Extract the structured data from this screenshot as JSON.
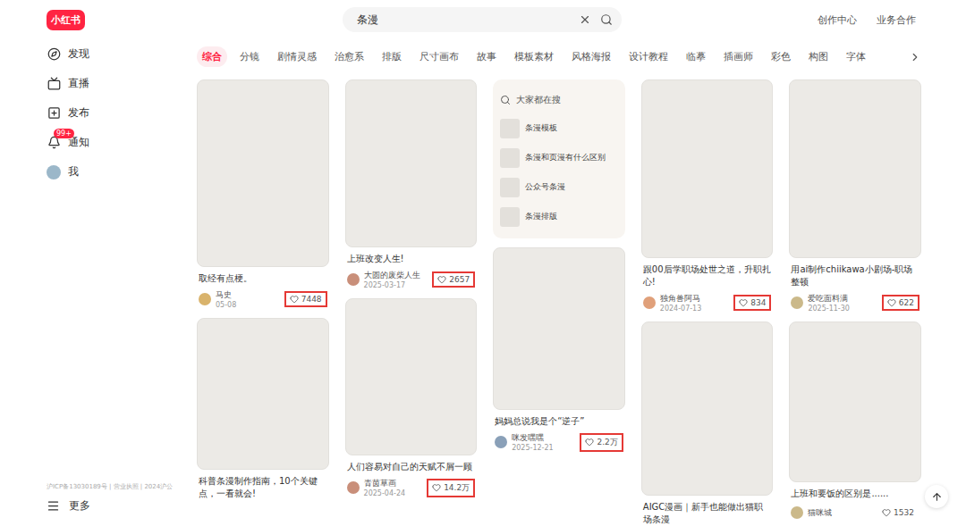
{
  "logo": "小红书",
  "search": {
    "value": "条漫"
  },
  "header_links": [
    "创作中心",
    "业务合作"
  ],
  "sidebar": {
    "items": [
      {
        "label": "发现",
        "selected": false,
        "icon": "compass"
      },
      {
        "label": "直播",
        "selected": false,
        "icon": "tv"
      },
      {
        "label": "发布",
        "selected": false,
        "icon": "plus"
      },
      {
        "label": "通知",
        "selected": false,
        "icon": "bell",
        "badge": "99+"
      },
      {
        "label": "我",
        "selected": false,
        "icon": "avatar"
      }
    ],
    "footer": "沪ICP备13030189号 | 营业执照 | 2024沪公",
    "more": "更多"
  },
  "tabs": [
    {
      "label": "综合",
      "selected": true
    },
    {
      "label": "分镜",
      "selected": false
    },
    {
      "label": "剧情灵感",
      "selected": false
    },
    {
      "label": "治愈系",
      "selected": false
    },
    {
      "label": "排版",
      "selected": false
    },
    {
      "label": "尺寸画布",
      "selected": false
    },
    {
      "label": "故事",
      "selected": false
    },
    {
      "label": "模板素材",
      "selected": false
    },
    {
      "label": "风格海报",
      "selected": false
    },
    {
      "label": "设计教程",
      "selected": false
    },
    {
      "label": "临摹",
      "selected": false
    },
    {
      "label": "插画师",
      "selected": false
    },
    {
      "label": "彩色",
      "selected": false
    },
    {
      "label": "构图",
      "selected": false
    },
    {
      "label": "字体",
      "selected": false
    }
  ],
  "columns": [
    [
      {
        "kind": "note",
        "title": "取经有点梗。",
        "author": "马史",
        "date": "05-08",
        "likes": "7448",
        "highlighted": true
      },
      {
        "kind": "note",
        "title": "科普条漫制作指南，10个关键点，一看就会!"
      }
    ],
    [
      {
        "kind": "note",
        "title": "上班改变人生!",
        "author": "大圆的废柴人生",
        "date": "2025-03-17",
        "likes": "2657",
        "highlighted": true
      },
      {
        "kind": "note",
        "title": "人们容易对自己的天赋不屑一顾",
        "author": "青茵草画",
        "date": "2025-04-24",
        "likes": "14.2万",
        "highlighted": true
      }
    ],
    [
      {
        "kind": "suggestions",
        "title": "大家都在搜",
        "items": [
          "条漫模板",
          "条漫和页漫有什么区别",
          "公众号条漫",
          "条漫排版"
        ]
      },
      {
        "kind": "note",
        "title": "妈妈总说我是个“逆子”",
        "author": "咪发嘿嘿",
        "date": "2025-12-21",
        "likes": "2.2万",
        "highlighted": true
      }
    ],
    [
      {
        "kind": "note",
        "title": "跟00后学职场处世之道，升职扎心!",
        "author": "独角兽阿马",
        "date": "2024-07-13",
        "likes": "834",
        "highlighted": true
      },
      {
        "kind": "note",
        "title": "AIGC漫画｜新手也能做出猫职场条漫"
      }
    ],
    [
      {
        "kind": "note",
        "title": "用ai制作chiikawa小剧场-职场整顿",
        "author": "爱吃面料满",
        "date": "2025-11-30",
        "likes": "622",
        "highlighted": true
      },
      {
        "kind": "note",
        "title": "上班和要饭的区别是......",
        "author": "猫咪城",
        "likes": "1532",
        "highlighted": false
      }
    ]
  ]
}
